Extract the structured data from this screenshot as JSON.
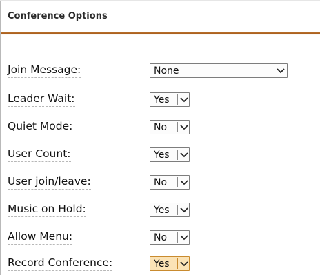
{
  "panel": {
    "title": "Conference Options"
  },
  "options": [
    {
      "label": "Join Message:",
      "value": "None"
    },
    {
      "label": "Leader Wait:",
      "value": "Yes"
    },
    {
      "label": "Quiet Mode:",
      "value": "No"
    },
    {
      "label": "User Count:",
      "value": "Yes"
    },
    {
      "label": "User join/leave:",
      "value": "No"
    },
    {
      "label": "Music on Hold:",
      "value": "Yes"
    },
    {
      "label": "Allow Menu:",
      "value": "No"
    },
    {
      "label": "Record Conference:",
      "value": "Yes"
    }
  ],
  "colors": {
    "accent_rule": "#b86a27",
    "focused_select_bg": "#fbe3b6",
    "focused_select_border": "#c98b2f"
  },
  "icons": {
    "dropdown": "chevron-down-icon"
  }
}
